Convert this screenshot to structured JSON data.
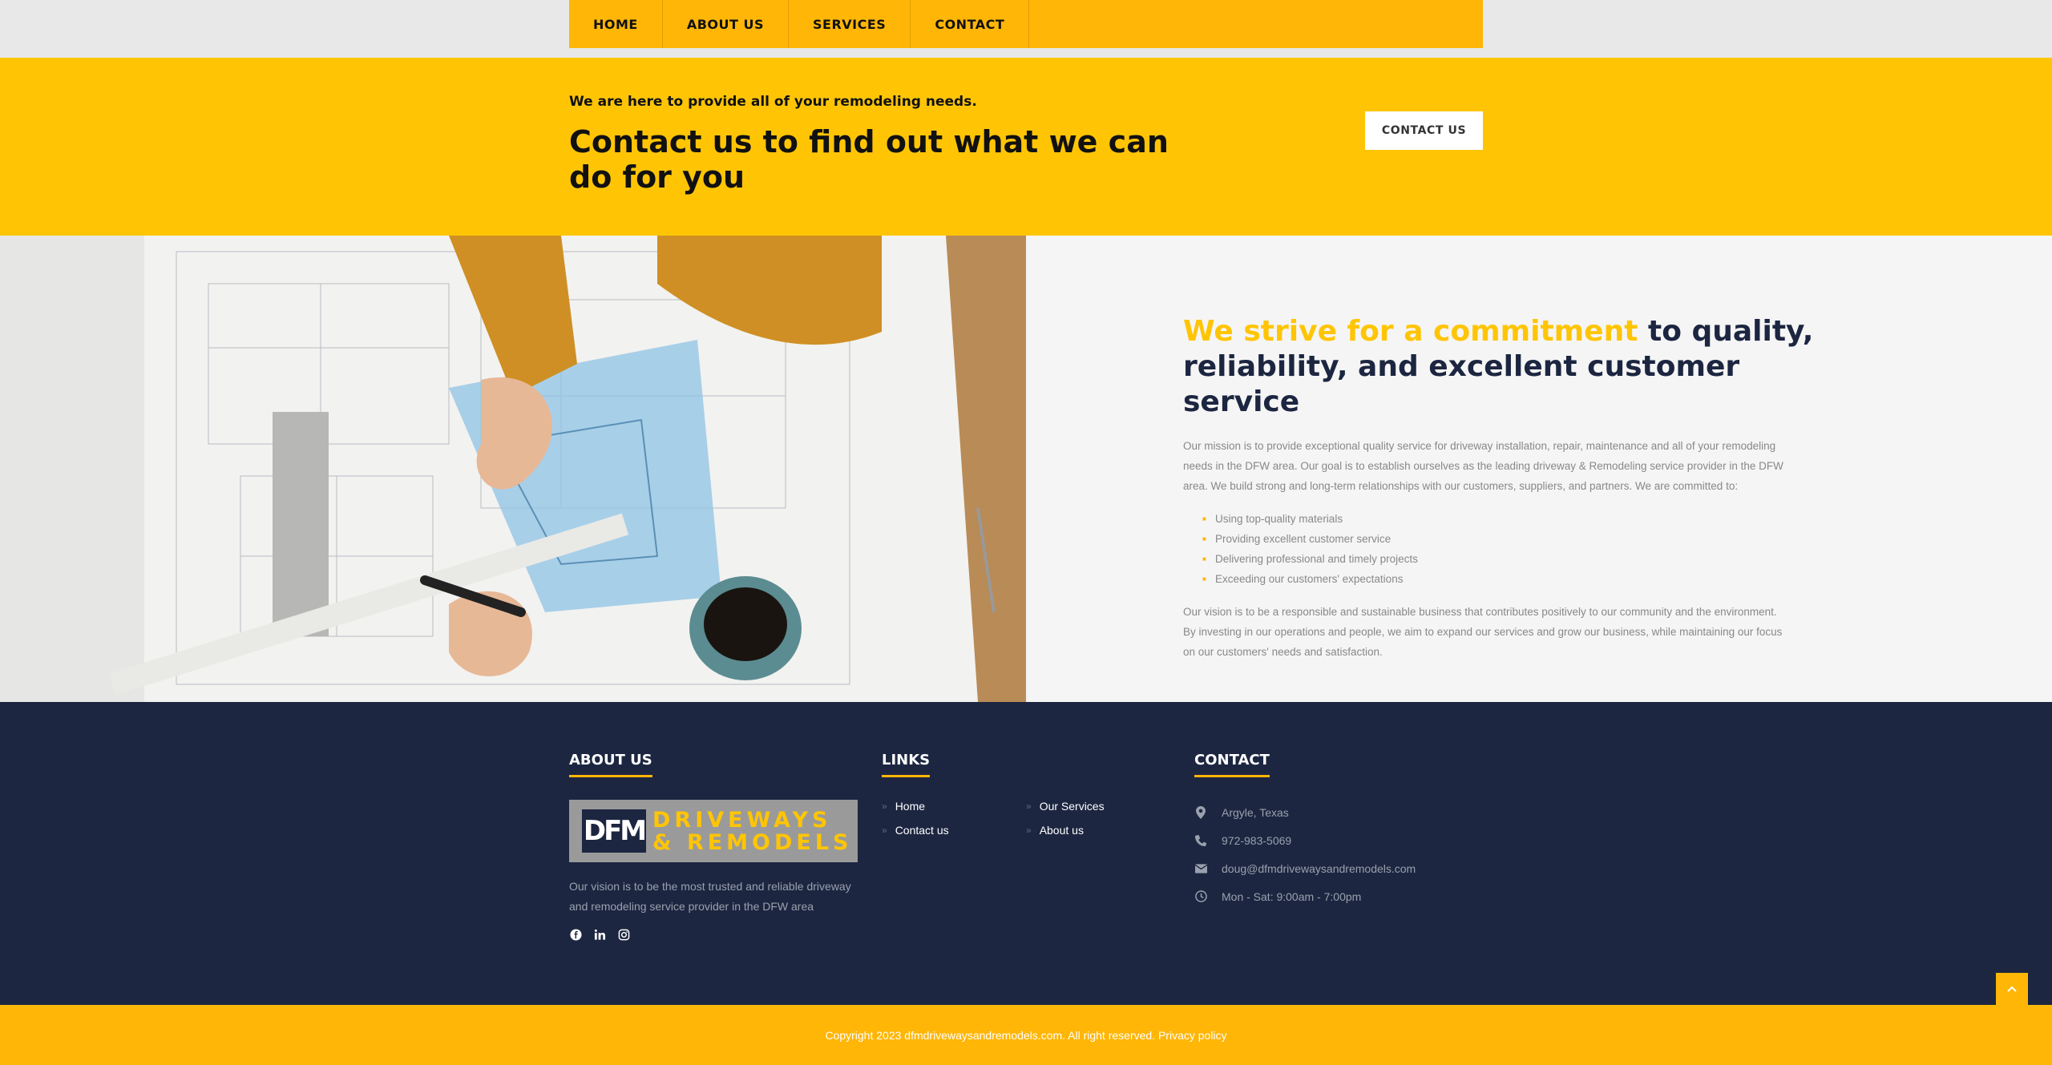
{
  "nav": {
    "items": [
      {
        "label": "HOME"
      },
      {
        "label": "ABOUT US"
      },
      {
        "label": "SERVICES"
      },
      {
        "label": "CONTACT"
      }
    ]
  },
  "cta": {
    "kicker": "We are here to provide all of your remodeling needs.",
    "title": "Contact us to find out what we can do for you",
    "button": "CONTACT US"
  },
  "mission": {
    "photo_icon": "blueprint-drafting-photo",
    "heading_accent": "We strive for a commitment",
    "heading_rest": " to quality, reliability, and excellent customer service",
    "paragraph1": "Our mission is to provide exceptional quality service for driveway installation, repair, maintenance and all of your remodeling needs in the DFW area.  Our goal is to establish ourselves as the leading driveway & Remodeling service provider in the DFW area. We build strong and long-term relationships with our customers, suppliers, and partners. We are committed to:",
    "list": [
      "Using top-quality materials",
      "Providing excellent customer service",
      "Delivering professional and timely projects",
      "Exceeding our customers' expectations"
    ],
    "paragraph2": "Our vision is to be a responsible and sustainable business that contributes positively to our community and the environment.  By investing in our operations and people, we aim to expand our services and grow our business, while maintaining our focus on our customers' needs and satisfaction."
  },
  "footer": {
    "about": {
      "heading": "ABOUT US",
      "logo_mark": "DFM",
      "logo_line1": "DRIVEWAYS",
      "logo_line2": "& REMODELS",
      "text": "Our vision is to be the most trusted and reliable driveway and remodeling service provider in the DFW area",
      "social": [
        "facebook-icon",
        "linkedin-icon",
        "instagram-icon"
      ]
    },
    "links": {
      "heading": "LINKS",
      "items": [
        {
          "label": "Home"
        },
        {
          "label": "Our Services"
        },
        {
          "label": "Contact us"
        },
        {
          "label": "About us"
        }
      ]
    },
    "contact": {
      "heading": "CONTACT",
      "items": [
        {
          "icon": "map-pin-icon",
          "text": "Argyle, Texas"
        },
        {
          "icon": "phone-icon",
          "text": "972-983-5069"
        },
        {
          "icon": "envelope-icon",
          "text": "doug@dfmdrivewaysandremodels.com"
        },
        {
          "icon": "clock-icon",
          "text": "Mon - Sat: 9:00am - 7:00pm"
        }
      ]
    }
  },
  "copyright": "Copyright 2023 dfmdrivewaysandremodels.com. All right reserved. Privacy policy",
  "colors": {
    "accent": "#ffc505",
    "accent_dark": "#ffb606",
    "navy": "#1c2641",
    "muted_text": "#888888"
  }
}
